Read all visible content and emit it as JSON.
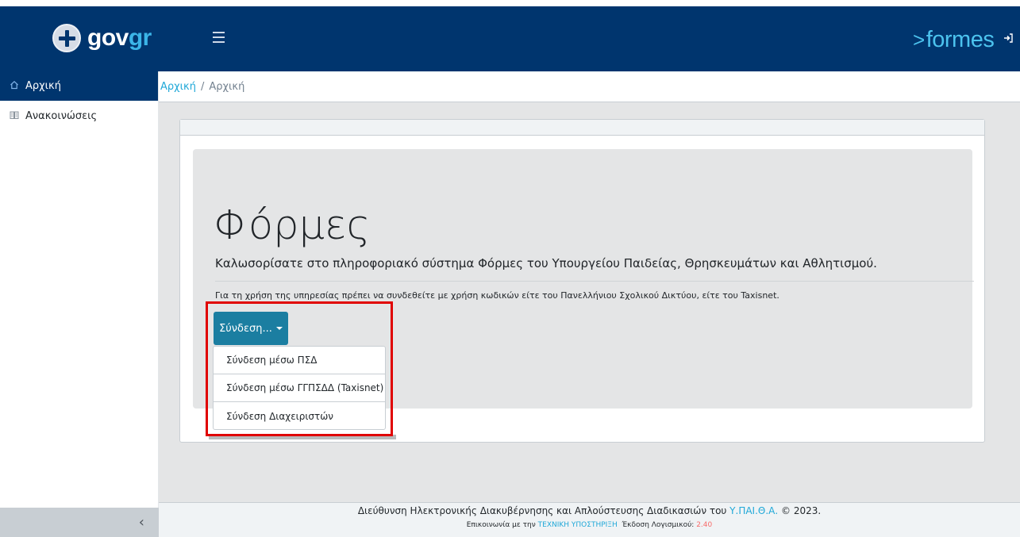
{
  "header": {
    "logo_gov": "gov",
    "logo_gr": "gr",
    "formes_arrow": ">",
    "formes_text": "formes"
  },
  "sidebar": {
    "items": [
      {
        "icon": "home-icon",
        "label": "Αρχική",
        "active": true
      },
      {
        "icon": "book-icon",
        "label": "Ανακοινώσεις",
        "active": false
      }
    ],
    "minimizer": "‹"
  },
  "breadcrumb": {
    "link": "Αρχική",
    "separator": "/",
    "current": "Αρχική"
  },
  "jumbotron": {
    "title": "Φόρμες",
    "lead": "Καλωσορίσατε στο πληροφοριακό σύστημα Φόρμες του Υπουργείου Παιδείας, Θρησκευμάτων και Αθλητισμού.",
    "note": "Για τη χρήση της υπηρεσίας πρέπει να συνδεθείτε με χρήση κωδικών είτε του Πανελλήνιου Σχολικού Δικτύου, είτε του Taxisnet."
  },
  "login_button": {
    "label": "Σύνδεση..."
  },
  "dropdown": {
    "items": [
      "Σύνδεση μέσω ΠΣΔ",
      "Σύνδεση μέσω ΓΓΠΣΔΔ (Taxisnet)",
      "Σύνδεση Διαχειριστών"
    ]
  },
  "footer": {
    "line1_prefix": "Διεύθυνση Ηλεκτρονικής Διακυβέρνησης και Απλούστευσης Διαδικασιών του ",
    "line1_link": "Υ.ΠΑΙ.Θ.Α.",
    "line1_suffix": " © 2023.",
    "line2_prefix": "Επικοινωνία με την ",
    "line2_link": "ΤΕΧΝΙΚΗ ΥΠΟΣΤΗΡΙΞΗ",
    "line2_version_label": "  Έκδοση Λογισμικού: ",
    "line2_version": "2.40"
  },
  "colors": {
    "header_bg": "#00356e",
    "accent": "#20a8d8",
    "button": "#1b7ea1",
    "highlight": "#e00000",
    "version": "#f86c6b"
  }
}
